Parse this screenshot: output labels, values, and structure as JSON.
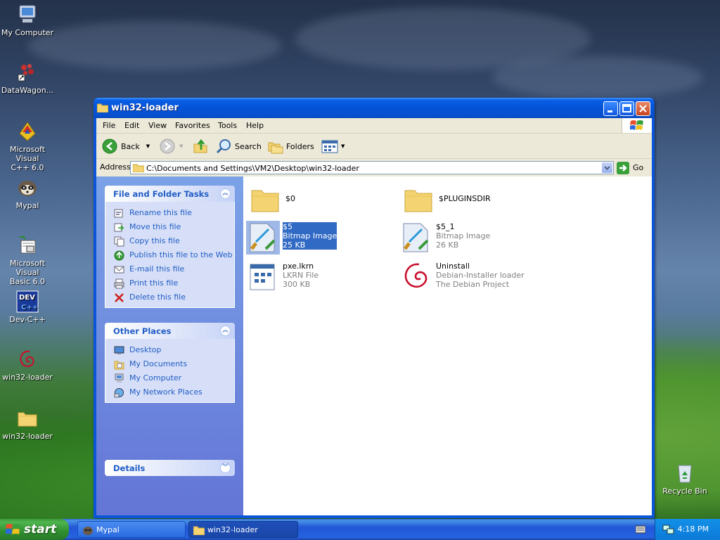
{
  "desktop": {
    "icons": [
      {
        "label": "My Computer"
      },
      {
        "label": "DataWagon..."
      },
      {
        "label_line1": "Microsoft Visual",
        "label_line2": "C++ 6.0"
      },
      {
        "label": "Mypal"
      },
      {
        "label_line1": "Microsoft Visual",
        "label_line2": "Basic 6.0"
      },
      {
        "label": "Dev-C++"
      },
      {
        "label": "win32-loader"
      },
      {
        "label": "win32-loader"
      }
    ],
    "recycle_bin": "Recycle Bin"
  },
  "window": {
    "title": "win32-loader",
    "menu": [
      "File",
      "Edit",
      "View",
      "Favorites",
      "Tools",
      "Help"
    ],
    "toolbar": {
      "back": "Back",
      "search": "Search",
      "folders": "Folders"
    },
    "address": {
      "label": "Address",
      "value": "C:\\Documents and Settings\\VM2\\Desktop\\win32-loader",
      "go": "Go"
    }
  },
  "taskpane": {
    "file_tasks": {
      "title": "File and Folder Tasks",
      "items": [
        "Rename this file",
        "Move this file",
        "Copy this file",
        "Publish this file to the Web",
        "E-mail this file",
        "Print this file",
        "Delete this file"
      ]
    },
    "other_places": {
      "title": "Other Places",
      "items": [
        "Desktop",
        "My Documents",
        "My Computer",
        "My Network Places"
      ]
    },
    "details": {
      "title": "Details"
    }
  },
  "files": [
    {
      "name": "$0",
      "type": "",
      "size": ""
    },
    {
      "name": "$PLUGINSDIR",
      "type": "",
      "size": ""
    },
    {
      "name": "$5",
      "type": "Bitmap Image",
      "size": "25 KB",
      "selected": true
    },
    {
      "name": "$5_1",
      "type": "Bitmap Image",
      "size": "26 KB"
    },
    {
      "name": "pxe.lkrn",
      "type": "LKRN File",
      "size": "300 KB"
    },
    {
      "name": "Uninstall",
      "type": "Debian-Installer loader",
      "size": "The Debian Project"
    }
  ],
  "taskbar": {
    "start": "start",
    "tasks": [
      {
        "label": "Mypal"
      },
      {
        "label": "win32-loader"
      }
    ],
    "clock": "4:18 PM"
  },
  "colors": {
    "titlebar": "#0553d6",
    "taskpane_link": "#215dc6",
    "selection": "#316ac5",
    "start_green": "#2f8f2f"
  }
}
